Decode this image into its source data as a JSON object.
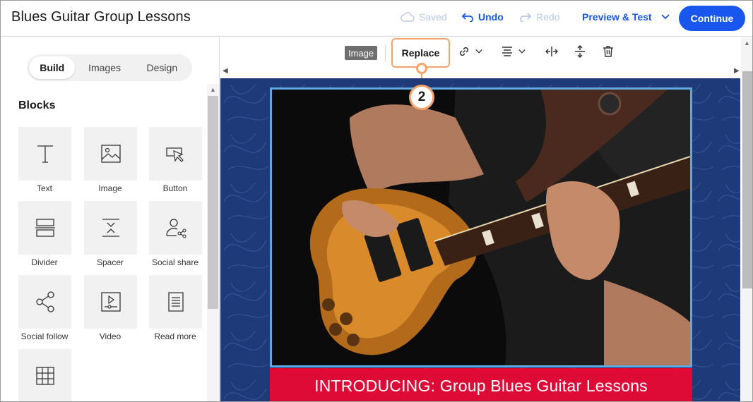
{
  "header": {
    "title": "Blues Guitar Group Lessons",
    "saved_label": "Saved",
    "undo_label": "Undo",
    "redo_label": "Redo",
    "preview_label": "Preview & Test",
    "continue_label": "Continue"
  },
  "sidebar": {
    "tabs": [
      {
        "label": "Build",
        "active": true
      },
      {
        "label": "Images",
        "active": false
      },
      {
        "label": "Design",
        "active": false
      }
    ],
    "blocks_heading": "Blocks",
    "blocks": [
      {
        "label": "Text",
        "icon": "text-icon"
      },
      {
        "label": "Image",
        "icon": "image-icon"
      },
      {
        "label": "Button",
        "icon": "button-icon"
      },
      {
        "label": "Divider",
        "icon": "divider-icon"
      },
      {
        "label": "Spacer",
        "icon": "spacer-icon"
      },
      {
        "label": "Social share",
        "icon": "social-share-icon"
      },
      {
        "label": "Social follow",
        "icon": "social-follow-icon"
      },
      {
        "label": "Video",
        "icon": "video-icon"
      },
      {
        "label": "Read more",
        "icon": "read-more-icon"
      },
      {
        "label": "",
        "icon": "table-icon"
      }
    ]
  },
  "toolbar": {
    "element_tag": "Image",
    "replace_label": "Replace",
    "callout_number": "2",
    "icons": [
      "link-icon",
      "align-icon",
      "horizontal-resize-icon",
      "vertical-resize-icon",
      "trash-icon"
    ]
  },
  "email": {
    "banner_text": "INTRODUCING: Group Blues Guitar Lessons",
    "background_color": "#1e3a78",
    "banner_color": "#df0b37",
    "selection_color": "#5fa8e0"
  },
  "colors": {
    "accent": "#1856ed",
    "callout": "#f5a36c"
  }
}
